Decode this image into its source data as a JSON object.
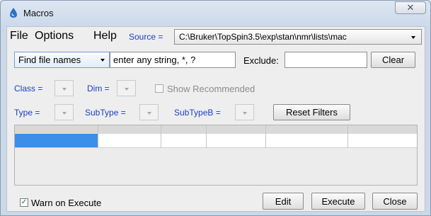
{
  "window": {
    "title": "Macros",
    "close_glyph": "✕"
  },
  "menu": {
    "file": "File",
    "options": "Options",
    "help": "Help"
  },
  "source": {
    "label": "Source =",
    "value": "C:\\Bruker\\TopSpin3.5\\exp\\stan\\nmr\\lists\\mac"
  },
  "search": {
    "mode": "Find file names",
    "input_value": "enter any string, *, ?",
    "exclude_label": "Exclude:",
    "exclude_value": "",
    "clear_label": "Clear"
  },
  "filters": {
    "class_label": "Class =",
    "dim_label": "Dim =",
    "show_recommended_label": "Show Recommended",
    "show_recommended_checked": false,
    "type_label": "Type =",
    "subtype_label": "SubType =",
    "subtypeb_label": "SubTypeB =",
    "reset_label": "Reset Filters"
  },
  "footer": {
    "warn_label": "Warn on Execute",
    "warn_checked": true,
    "check_glyph": "✓",
    "edit_label": "Edit",
    "execute_label": "Execute",
    "close_label": "Close"
  },
  "colors": {
    "label_blue": "#1a3fc4",
    "selection_blue": "#3b8fe8"
  }
}
